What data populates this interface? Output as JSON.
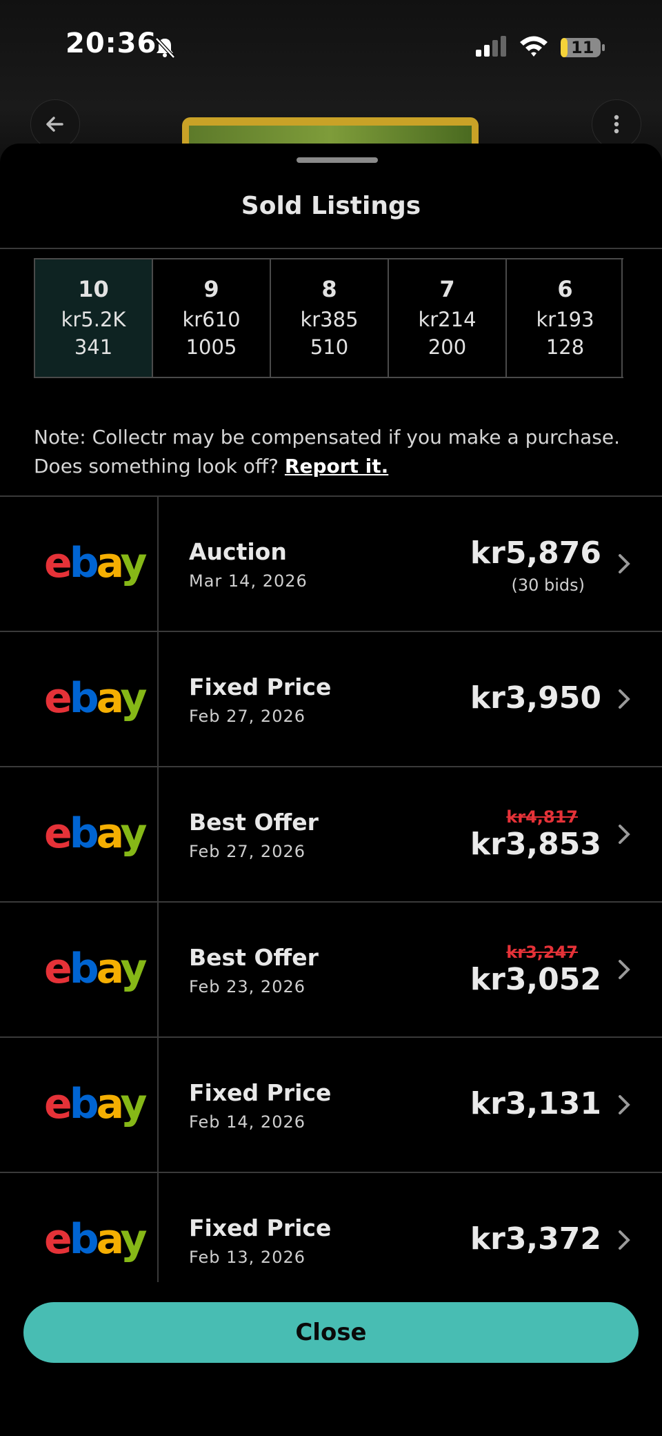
{
  "status_bar": {
    "time": "20:36",
    "battery": "11"
  },
  "sheet": {
    "title": "Sold Listings"
  },
  "grades": [
    {
      "grade": "10",
      "price": "kr5.2K",
      "count": "341"
    },
    {
      "grade": "9",
      "price": "kr610",
      "count": "1005"
    },
    {
      "grade": "8",
      "price": "kr385",
      "count": "510"
    },
    {
      "grade": "7",
      "price": "kr214",
      "count": "200"
    },
    {
      "grade": "6",
      "price": "kr193",
      "count": "128"
    }
  ],
  "note": {
    "line1": "Note: Collectr may be compensated if you make a purchase.",
    "line2": "Does something look off?",
    "link": "Report it."
  },
  "listings": [
    {
      "type": "Auction",
      "date": "Mar 14, 2026",
      "price": "kr5,876",
      "bids": "(30 bids)",
      "original": ""
    },
    {
      "type": "Fixed Price",
      "date": "Feb 27, 2026",
      "price": "kr3,950",
      "bids": "",
      "original": ""
    },
    {
      "type": "Best Offer",
      "date": "Feb 27, 2026",
      "price": "kr3,853",
      "bids": "",
      "original": "kr4,817"
    },
    {
      "type": "Best Offer",
      "date": "Feb 23, 2026",
      "price": "kr3,052",
      "bids": "",
      "original": "kr3,247"
    },
    {
      "type": "Fixed Price",
      "date": "Feb 14, 2026",
      "price": "kr3,131",
      "bids": "",
      "original": ""
    },
    {
      "type": "Fixed Price",
      "date": "Feb 13, 2026",
      "price": "kr3,372",
      "bids": "",
      "original": ""
    }
  ],
  "logo": {
    "e": "e",
    "b": "b",
    "a": "a",
    "y": "y"
  },
  "footer": {
    "close_label": "Close"
  },
  "colors": {
    "accent": "#48bdb3",
    "strike": "#e53238"
  }
}
